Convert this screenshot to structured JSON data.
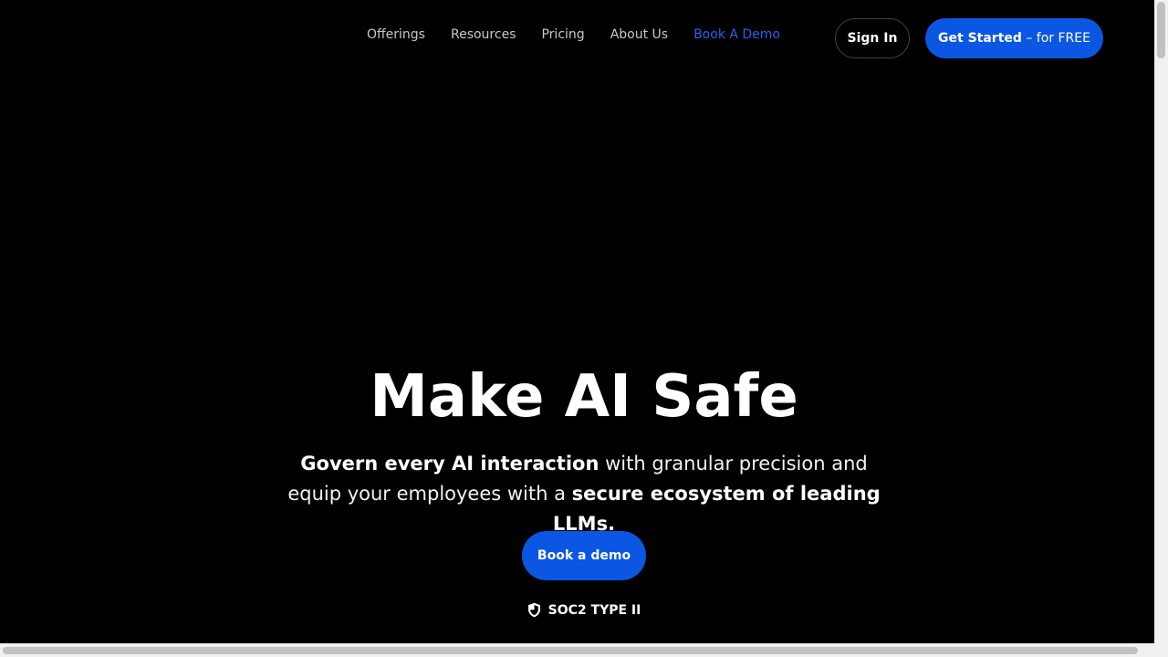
{
  "nav": {
    "links": [
      {
        "label": "Offerings"
      },
      {
        "label": "Resources"
      },
      {
        "label": "Pricing"
      },
      {
        "label": "About Us"
      },
      {
        "label": "Book A Demo"
      }
    ],
    "sign_in": "Sign In",
    "get_started_strong": "Get Started",
    "get_started_rest": " – for FREE"
  },
  "hero": {
    "title": "Make AI Safe",
    "sub_bold_1": "Govern every AI interaction",
    "sub_text_1": " with granular precision and equip your employees with a ",
    "sub_bold_2": "secure ecosystem of leading LLMs.",
    "cta": "Book a demo",
    "badge": "SOC2 TYPE II",
    "badge_icon": "shield-icon"
  },
  "colors": {
    "accent": "#0b57e3",
    "link_accent": "#2463eb",
    "background": "#000000"
  }
}
